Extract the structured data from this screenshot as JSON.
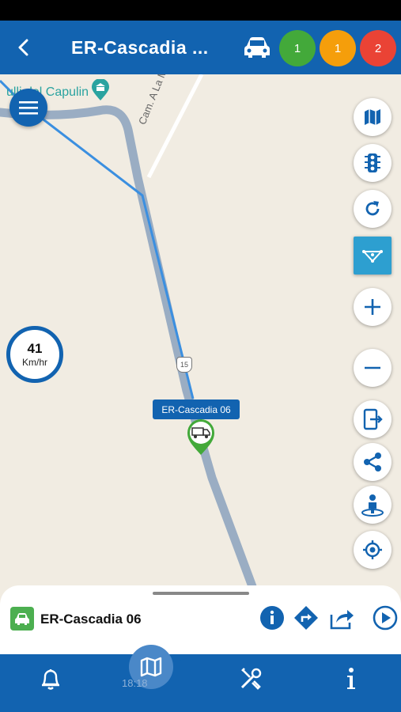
{
  "header": {
    "title": "ER-Cascadia ...",
    "back_icon": "chevron-left-icon",
    "vehicle_icon": "car-icon",
    "badges": [
      {
        "count": "1",
        "color": "#43a93a"
      },
      {
        "count": "1",
        "color": "#f59e0b"
      },
      {
        "count": "2",
        "color": "#ea4335"
      }
    ]
  },
  "map": {
    "poi_label": "ulli del Capulin",
    "street_label": "Cam. A La Mesilla",
    "route_shield": "15",
    "speed": {
      "value": "41",
      "unit": "Km/hr"
    },
    "vehicle_marker_label": "ER-Cascadia 06",
    "controls": [
      {
        "name": "map-layers-icon"
      },
      {
        "name": "traffic-light-icon"
      },
      {
        "name": "refresh-icon"
      },
      {
        "name": "route-filter-icon",
        "active": true
      },
      {
        "name": "zoom-in-icon"
      },
      {
        "name": "zoom-out-icon"
      },
      {
        "name": "phone-exit-icon"
      },
      {
        "name": "share-icon"
      },
      {
        "name": "street-view-icon"
      },
      {
        "name": "locate-icon"
      }
    ]
  },
  "panel": {
    "vehicle_name": "ER-Cascadia 06",
    "actions": [
      "info-icon",
      "directions-icon",
      "share-forward-icon",
      "play-icon"
    ]
  },
  "nav": {
    "items": [
      "bell-icon",
      "map-icon",
      "tools-icon",
      "info-icon"
    ],
    "clock": "18:18"
  },
  "colors": {
    "primary": "#1263b0",
    "accent": "#2d9fd0",
    "map_bg": "#f1ece2",
    "road": "#9aadc3",
    "route": "#3b8fe0"
  }
}
